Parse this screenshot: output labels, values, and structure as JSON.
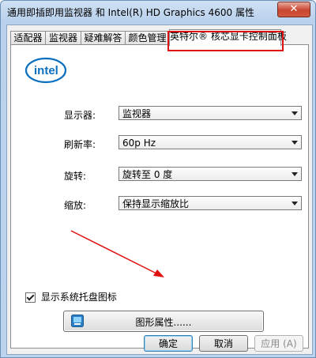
{
  "window": {
    "title": "通用即插即用监视器 和 Intel(R) HD Graphics 4600 属性",
    "close_glyph": "✕"
  },
  "tabs": [
    {
      "label": "适配器"
    },
    {
      "label": "监视器"
    },
    {
      "label": "疑难解答"
    },
    {
      "label": "颜色管理"
    },
    {
      "label": "英特尔® 核芯显卡控制面板",
      "active": true
    }
  ],
  "logo": {
    "text": "intel"
  },
  "settings": {
    "display": {
      "label": "显示器:",
      "value": "监视器"
    },
    "refresh": {
      "label": "刷新率:",
      "value": "60p Hz"
    },
    "rotation": {
      "label": "旋转:",
      "value": "旋转至 0 度"
    },
    "scaling": {
      "label": "缩放:",
      "value": "保持显示缩放比"
    }
  },
  "tray_checkbox": {
    "label": "显示系统托盘图标",
    "checked": true
  },
  "graphics_button": {
    "label": "图形属性......",
    "icon": "intel-graphics-icon"
  },
  "buttons": {
    "ok": "确定",
    "cancel": "取消",
    "apply": "应用 (A)"
  },
  "colors": {
    "highlight": "#e01010",
    "annotation_arrow": "#e01010"
  }
}
